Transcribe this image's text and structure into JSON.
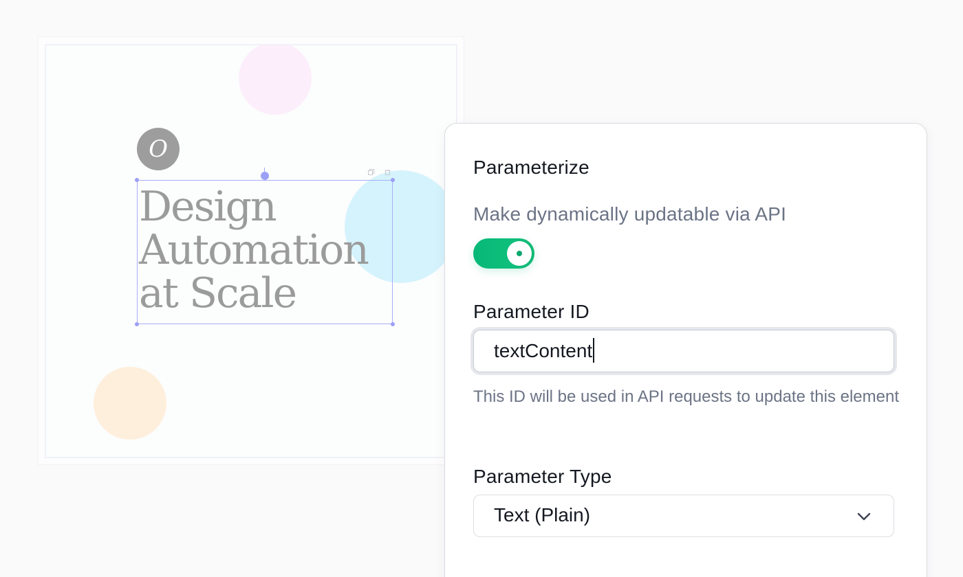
{
  "canvas": {
    "logo_glyph": "O",
    "headline_lines": [
      "Design",
      "Automation",
      "at Scale"
    ],
    "colors": {
      "pink_circle": "#fdeefb",
      "cyan_circle": "#d5f3fc",
      "peach_circle": "#feefdd",
      "logo_bg": "#9d9d9d",
      "headline_text": "#9b9b9b",
      "selection": "#a9aef6"
    },
    "icons": [
      "duplicate-icon",
      "delete-icon",
      "rotate-handle"
    ]
  },
  "panel": {
    "title": "Parameterize",
    "subtitle": "Make dynamically updatable via API",
    "toggle": {
      "state": "on",
      "color": "#10b981"
    },
    "parameter_id": {
      "label": "Parameter ID",
      "value": "textContent",
      "helper": "This ID will be used in API requests to update this element"
    },
    "parameter_type": {
      "label": "Parameter Type",
      "selected": "Text (Plain)",
      "icon": "chevron-down-icon"
    }
  }
}
